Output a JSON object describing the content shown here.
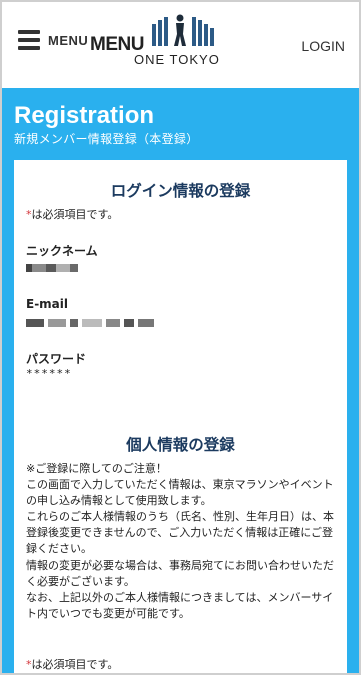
{
  "header": {
    "menu_label": "MENU",
    "logo_main": "MENU",
    "logo_sub": "ONE TOKYO",
    "login_label": "LOGIN"
  },
  "banner": {
    "title": "Registration",
    "subtitle": "新規メンバー情報登録（本登録）"
  },
  "login_section": {
    "title": "ログイン情報の登録",
    "required_star": "*",
    "required_note": "は必須項目です。",
    "nickname_label": "ニックネーム",
    "email_label": "E-mail",
    "password_label": "パスワード",
    "password_value": "******"
  },
  "personal_section": {
    "title": "個人情報の登録",
    "notice_lines": [
      "※ご登録に際してのご注意！",
      "この画面で入力していただく情報は、東京マラソンやイベントの申し込み情報として使用致します。",
      "これらのご本人様情報のうち（氏名、性別、生年月日）は、本登録後変更できませんので、ご入力いただく情報は正確にご登録ください。",
      "情報の変更が必要な場合は、事務局宛てにお問い合わせいただく必要がございます。",
      "なお、上記以外のご本人様情報につきましては、メンバーサイト内でいつでも変更が可能です。"
    ],
    "required_star": "*",
    "required_note": "は必須項目です。"
  },
  "colors": {
    "accent_blue": "#2ab0ee",
    "heading_navy": "#1b3a5f",
    "required_red": "#d3343b"
  }
}
